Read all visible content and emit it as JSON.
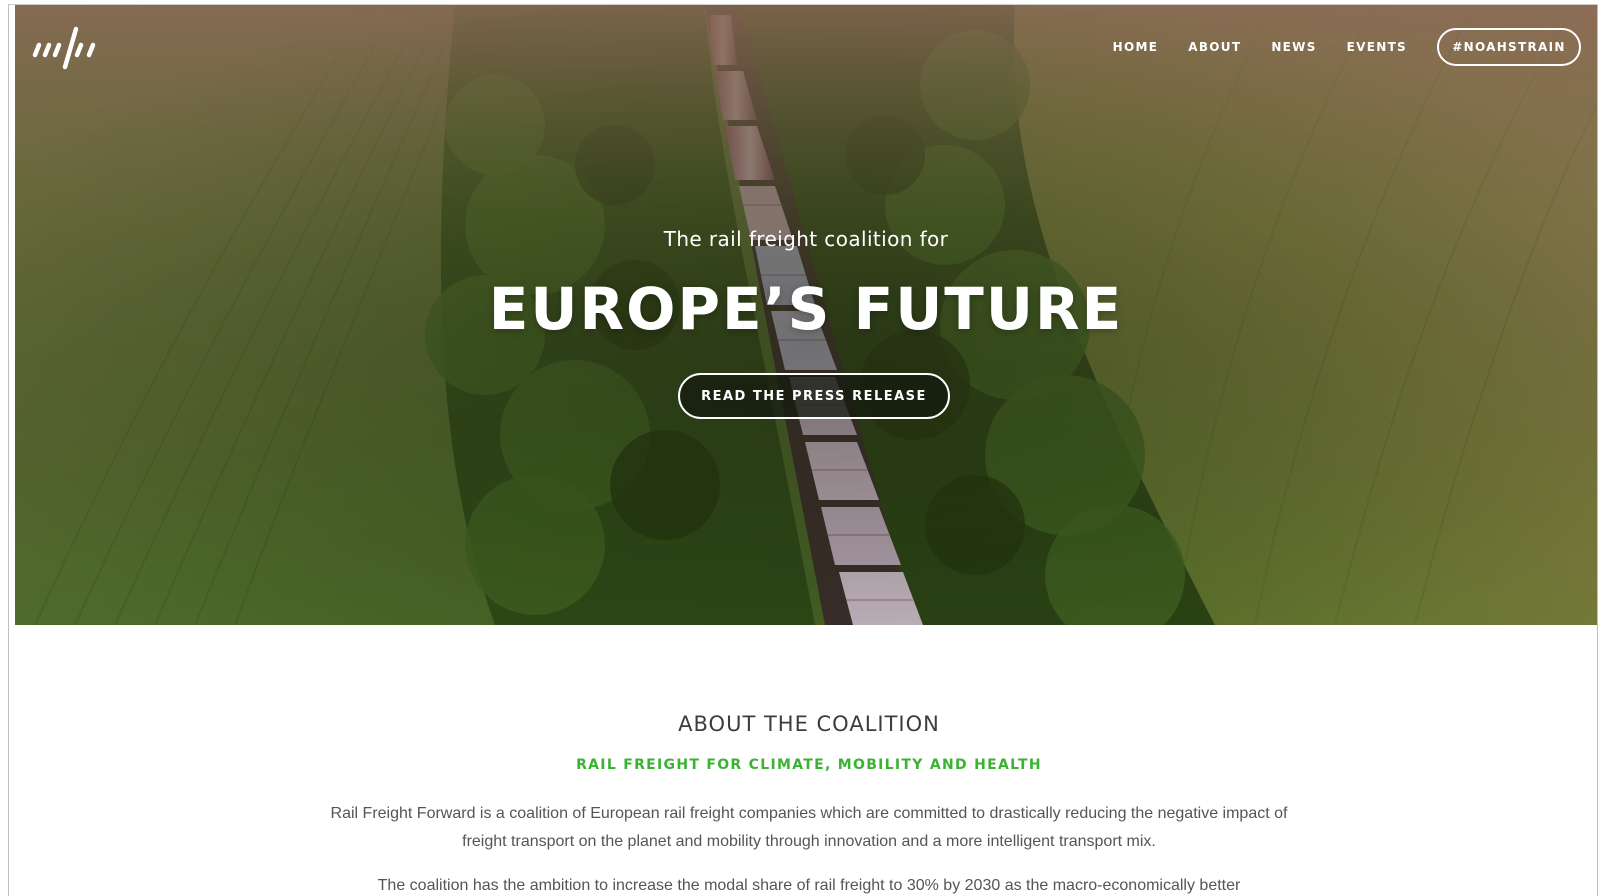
{
  "nav": {
    "links": [
      "HOME",
      "ABOUT",
      "NEWS",
      "EVENTS"
    ],
    "cta": "#NOAHSTRAIN"
  },
  "hero": {
    "kicker": "The rail freight coalition for",
    "headline": "EUROPE’S FUTURE",
    "button": "READ THE PRESS RELEASE"
  },
  "about": {
    "title": "ABOUT THE COALITION",
    "subtitle": "RAIL FREIGHT FOR CLIMATE, MOBILITY AND HEALTH",
    "paragraph1": "Rail Freight Forward is a coalition of European rail freight companies which are committed to drastically reducing the negative impact of freight transport on the planet and mobility through innovation and a more intelligent transport mix.",
    "paragraph2": "The coalition has the ambition to increase the modal share of rail freight to 30% by 2030 as the macro-economically better"
  },
  "colors": {
    "accent_green": "#3cb233",
    "heading_gray": "#3d3d3d",
    "body_gray": "#555555"
  }
}
